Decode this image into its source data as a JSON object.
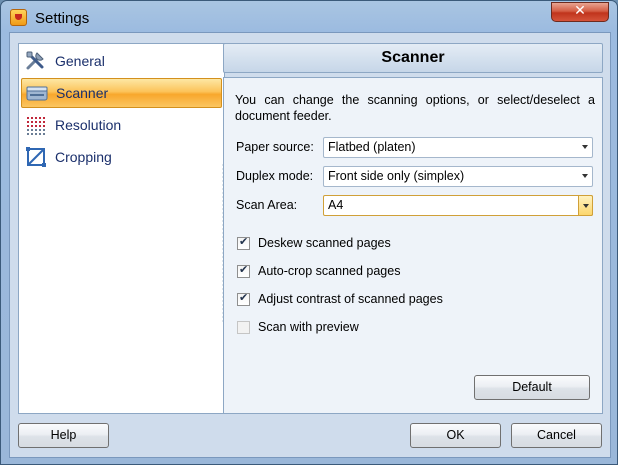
{
  "window": {
    "title": "Settings",
    "close_label": "✕"
  },
  "nav": {
    "items": [
      {
        "label": "General",
        "icon": "tools-icon",
        "selected": false
      },
      {
        "label": "Scanner",
        "icon": "scanner-icon",
        "selected": true
      },
      {
        "label": "Resolution",
        "icon": "resolution-grid-icon",
        "selected": false
      },
      {
        "label": "Cropping",
        "icon": "crop-icon",
        "selected": false
      }
    ]
  },
  "panel": {
    "title": "Scanner",
    "description": "You can change the scanning options, or select/deselect a document feeder.",
    "fields": {
      "paper_source": {
        "label": "Paper source:",
        "value": "Flatbed (platen)"
      },
      "duplex_mode": {
        "label": "Duplex mode:",
        "value": "Front side only (simplex)"
      },
      "scan_area": {
        "label": "Scan Area:",
        "value": "A4"
      }
    },
    "options": [
      {
        "label": "Deskew scanned pages",
        "checked": true,
        "enabled": true
      },
      {
        "label": "Auto-crop scanned pages",
        "checked": true,
        "enabled": true
      },
      {
        "label": "Adjust contrast of scanned pages",
        "checked": true,
        "enabled": true
      },
      {
        "label": "Scan with preview",
        "checked": false,
        "enabled": false
      }
    ],
    "default_button": "Default"
  },
  "footer": {
    "help_button": "Help",
    "ok_button": "OK",
    "cancel_button": "Cancel"
  },
  "colors": {
    "selection": "#fcc35a",
    "nav_text": "#1a2f6b",
    "frame": "#9cbbe0"
  }
}
